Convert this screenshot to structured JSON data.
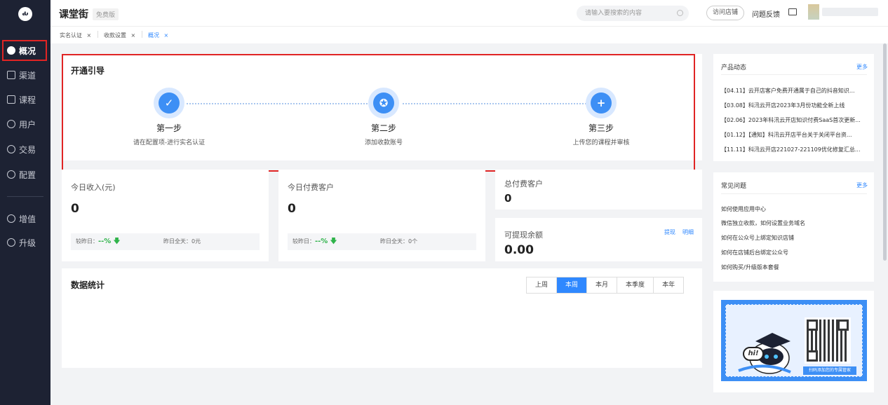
{
  "app": {
    "brand": "课堂街",
    "edition_badge": "免费版",
    "logo_text": "ԃ"
  },
  "sidebar": {
    "items": [
      {
        "label": "概况",
        "icon": "pie-chart-icon",
        "active": true
      },
      {
        "label": "渠道",
        "icon": "channel-icon"
      },
      {
        "label": "课程",
        "icon": "book-icon"
      },
      {
        "label": "用户",
        "icon": "user-icon"
      },
      {
        "label": "交易",
        "icon": "exchange-icon"
      },
      {
        "label": "配置",
        "icon": "gear-icon"
      },
      {
        "label": "增值",
        "icon": "value-added-icon"
      },
      {
        "label": "升级",
        "icon": "upgrade-icon"
      }
    ]
  },
  "header": {
    "search_placeholder": "请输入要搜索的内容",
    "visit_shop": "访问店铺",
    "feedback": "问题反馈"
  },
  "tabs": [
    {
      "label": "实名认证",
      "close": "×"
    },
    {
      "label": "收款设置",
      "close": "×"
    },
    {
      "label": "概况",
      "close": "×",
      "active": true
    }
  ],
  "guide": {
    "title": "开通引导",
    "steps": [
      {
        "name": "第一步",
        "desc": "请在配置项-进行实名认证",
        "glyph": "✓"
      },
      {
        "name": "第二步",
        "desc": "添加收款账号",
        "glyph": "✪"
      },
      {
        "name": "第三步",
        "desc": "上传您的课程并审核",
        "glyph": "+"
      }
    ]
  },
  "stats": {
    "today_income": {
      "label": "今日收入(元)",
      "value": "0",
      "compare_label": "较昨日：",
      "compare_pct": "--%",
      "arrow": "🡇",
      "yesterday": "昨日全天：0元"
    },
    "today_paying": {
      "label": "今日付费客户",
      "value": "0",
      "compare_label": "较昨日：",
      "compare_pct": "--%",
      "arrow": "🡇",
      "yesterday": "昨日全天：0个"
    },
    "total_paying": {
      "label": "总付费客户",
      "value": "0"
    },
    "withdrawable": {
      "label": "可提现余额",
      "value": "0.00",
      "withdraw": "提现",
      "detail": "明细"
    }
  },
  "data_stats": {
    "title": "数据统计",
    "periods": [
      "上周",
      "本周",
      "本月",
      "本季度",
      "本年"
    ],
    "active_period": "本周"
  },
  "product_news": {
    "title": "产品动态",
    "more": "更多",
    "items": [
      "【04.11】云开店客户免费开通属于自己的抖音知识...",
      "【03.08】科汛云开店2023年3月份功能全新上线",
      "【02.06】2023年科汛云开店知识付费SaaS首次更新...",
      "【01.12】【通知】科汛云开店平台关于关闭平台资...",
      "【11.11】科汛云开店221027-221109优化修复汇总..."
    ]
  },
  "faq": {
    "title": "常见问题",
    "more": "更多",
    "items": [
      "如何使用应用中心",
      "微信独立收款，如何设置业务域名",
      "如何在公众号上绑定知识店铺",
      "如何在店铺后台绑定公众号",
      "如何购买/升级版本套餐"
    ]
  },
  "promo": {
    "caption": "扫码添加您的专属管家",
    "bubble": "hi!"
  }
}
